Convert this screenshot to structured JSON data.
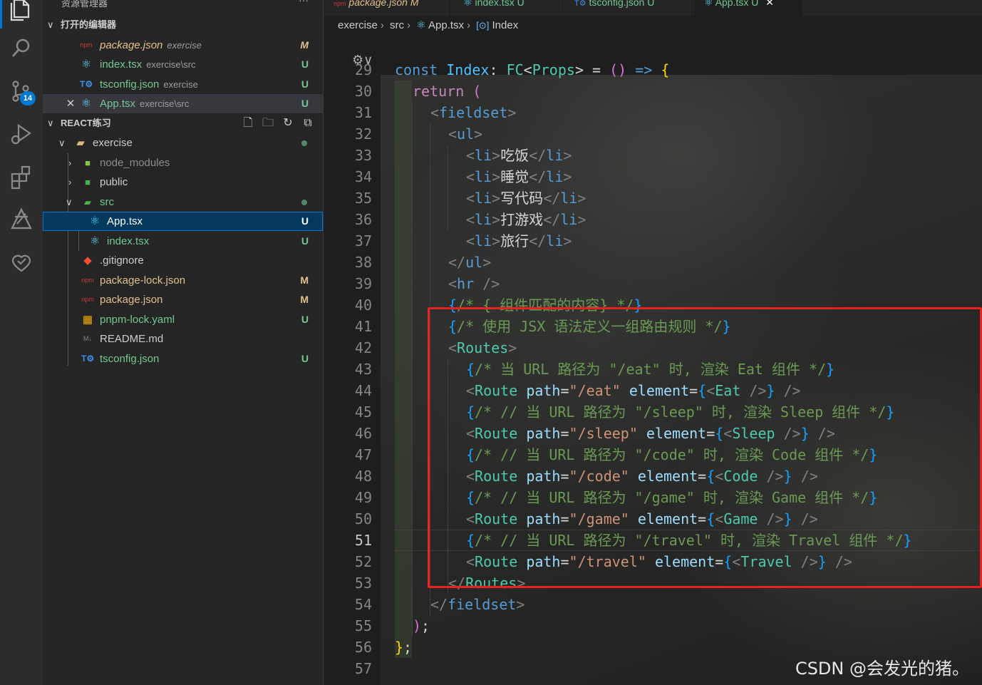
{
  "activity": {
    "icons": [
      "explorer-icon",
      "search-icon",
      "source-control-icon",
      "run-debug-icon",
      "extensions-icon",
      "remote-explorer-icon",
      "testing-icon"
    ],
    "scm_badge": "14"
  },
  "sidebar": {
    "title": "资源管理器",
    "open_editors": {
      "header": "打开的编辑器",
      "items": [
        {
          "icon": "json",
          "name": "package.json",
          "desc": "exercise",
          "status": "M"
        },
        {
          "icon": "react",
          "name": "index.tsx",
          "desc": "exercise\\src",
          "status": "U"
        },
        {
          "icon": "ts",
          "name": "tsconfig.json",
          "desc": "exercise",
          "status": "U"
        },
        {
          "icon": "react",
          "name": "App.tsx",
          "desc": "exercise\\src",
          "status": "U",
          "close": "✕"
        }
      ]
    },
    "project": {
      "header": "REACT练习",
      "tree": [
        {
          "name": "exercise",
          "type": "folder-open",
          "status": ""
        },
        {
          "name": "node_modules",
          "type": "folder",
          "status": ""
        },
        {
          "name": "public",
          "type": "folder",
          "status": ""
        },
        {
          "name": "src",
          "type": "folder-open",
          "status": ""
        },
        {
          "name": "App.tsx",
          "type": "react",
          "status": "U"
        },
        {
          "name": "index.tsx",
          "type": "react",
          "status": "U"
        },
        {
          "name": ".gitignore",
          "type": "git",
          "status": ""
        },
        {
          "name": "package-lock.json",
          "type": "json",
          "status": "M"
        },
        {
          "name": "package.json",
          "type": "json",
          "status": "M"
        },
        {
          "name": "pnpm-lock.yaml",
          "type": "yaml",
          "status": "U"
        },
        {
          "name": "README.md",
          "type": "md",
          "status": ""
        },
        {
          "name": "tsconfig.json",
          "type": "ts",
          "status": "U"
        }
      ]
    }
  },
  "tabs": [
    {
      "name": "package.json",
      "status": "M"
    },
    {
      "name": "index.tsx",
      "status": "U"
    },
    {
      "name": "tsconfig.json",
      "status": "U"
    },
    {
      "name": "App.tsx",
      "status": "U",
      "close": "✕"
    }
  ],
  "breadcrumb": [
    "exercise",
    "src",
    "App.tsx",
    "Index"
  ],
  "editor": {
    "current_line": 51,
    "line_numbers": [
      "29",
      "30",
      "31",
      "32",
      "33",
      "34",
      "35",
      "36",
      "37",
      "38",
      "39",
      "40",
      "41",
      "42",
      "43",
      "44",
      "45",
      "46",
      "47",
      "48",
      "49",
      "50",
      "51",
      "52",
      "53",
      "54",
      "55",
      "56",
      "57"
    ],
    "code": {
      "l29": {
        "a": "const",
        "b": "Index",
        "c": ": ",
        "d": "FC",
        "e": "<",
        "f": "Props",
        "g": ">",
        "h": " = ",
        "i": "()",
        "j": " => ",
        "k": "{"
      },
      "l30": {
        "a": "return",
        "b": " ("
      },
      "l31": {
        "a": "<",
        "b": "fieldset",
        "c": ">"
      },
      "l32": {
        "a": "<",
        "b": "ul",
        "c": ">"
      },
      "l33": {
        "a": "<",
        "b": "li",
        "c": ">",
        "d": "吃饭",
        "e": "</",
        "f": "li",
        "g": ">"
      },
      "l34": {
        "a": "<",
        "b": "li",
        "c": ">",
        "d": "睡觉",
        "e": "</",
        "f": "li",
        "g": ">"
      },
      "l35": {
        "a": "<",
        "b": "li",
        "c": ">",
        "d": "写代码",
        "e": "</",
        "f": "li",
        "g": ">"
      },
      "l36": {
        "a": "<",
        "b": "li",
        "c": ">",
        "d": "打游戏",
        "e": "</",
        "f": "li",
        "g": ">"
      },
      "l37": {
        "a": "<",
        "b": "li",
        "c": ">",
        "d": "旅行",
        "e": "</",
        "f": "li",
        "g": ">"
      },
      "l38": {
        "a": "</",
        "b": "ul",
        "c": ">"
      },
      "l39": {
        "a": "<",
        "b": "hr",
        "c": " />"
      },
      "l40": {
        "a": "{",
        "b": "/* { 组件匹配的内容} */",
        "c": "}"
      },
      "l41": {
        "a": "{",
        "b": "/* 使用 JSX 语法定义一组路由规则 */",
        "c": "}"
      },
      "l42": {
        "a": "<",
        "b": "Routes",
        "c": ">"
      },
      "l43": {
        "a": "{",
        "b": "/* 当 URL 路径为 \"/eat\" 时, 渲染 Eat 组件 */",
        "c": "}"
      },
      "l44": {
        "a": "<",
        "b": "Route",
        "c": "path",
        "d": "=",
        "e": "\"/eat\"",
        "f": "element",
        "g": "=",
        "h": "{",
        "i": "<",
        "j": "Eat",
        "k": " />",
        "l": "}",
        "m": " />"
      },
      "l45": {
        "a": "{",
        "b": "/* // 当 URL 路径为 \"/sleep\" 时, 渲染 Sleep 组件 */",
        "c": "}"
      },
      "l46": {
        "a": "<",
        "b": "Route",
        "c": "path",
        "d": "=",
        "e": "\"/sleep\"",
        "f": "element",
        "g": "=",
        "h": "{",
        "i": "<",
        "j": "Sleep",
        "k": " />",
        "l": "}",
        "m": " />"
      },
      "l47": {
        "a": "{",
        "b": "/* // 当 URL 路径为 \"/code\" 时, 渲染 Code 组件 */",
        "c": "}"
      },
      "l48": {
        "a": "<",
        "b": "Route",
        "c": "path",
        "d": "=",
        "e": "\"/code\"",
        "f": "element",
        "g": "=",
        "h": "{",
        "i": "<",
        "j": "Code",
        "k": " />",
        "l": "}",
        "m": " />"
      },
      "l49": {
        "a": "{",
        "b": "/* // 当 URL 路径为 \"/game\" 时, 渲染 Game 组件 */",
        "c": "}"
      },
      "l50": {
        "a": "<",
        "b": "Route",
        "c": "path",
        "d": "=",
        "e": "\"/game\"",
        "f": "element",
        "g": "=",
        "h": "{",
        "i": "<",
        "j": "Game",
        "k": " />",
        "l": "}",
        "m": " />"
      },
      "l51": {
        "a": "{",
        "b": "/* // 当 URL 路径为 \"/travel\" 时, 渲染 Travel 组件 */",
        "c": "}"
      },
      "l52": {
        "a": "<",
        "b": "Route",
        "c": "path",
        "d": "=",
        "e": "\"/travel\"",
        "f": "element",
        "g": "=",
        "h": "{",
        "i": "<",
        "j": "Travel",
        "k": " />",
        "l": "}",
        "m": " />"
      },
      "l53": {
        "a": "</",
        "b": "Routes",
        "c": ">"
      },
      "l54": {
        "a": "</",
        "b": "fieldset",
        "c": ">"
      },
      "l55": {
        "a": ")",
        "b": ";"
      },
      "l56": {
        "a": "}",
        "b": ";"
      },
      "l57": {
        "a": ""
      }
    }
  },
  "watermark": "CSDN @会发光的猪。",
  "colors": {
    "accent": "#0078d4",
    "highlight_box": "#e8231f",
    "modified": "#e2c08d",
    "untracked": "#73c991"
  }
}
